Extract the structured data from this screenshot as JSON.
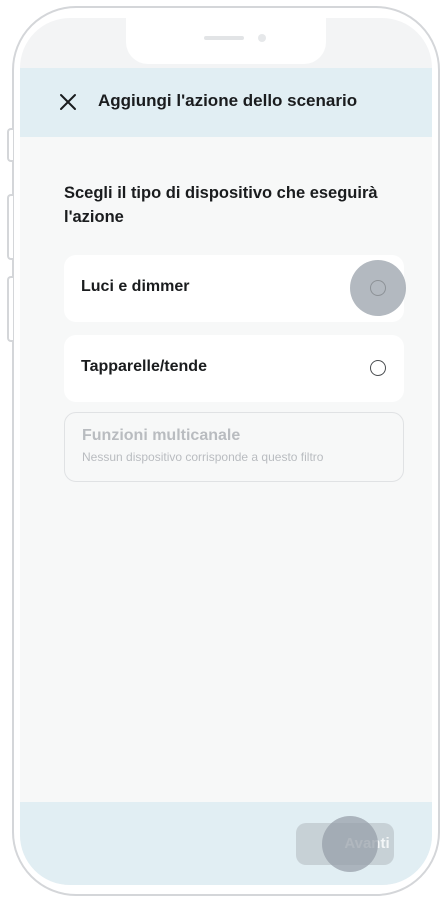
{
  "header": {
    "title": "Aggiungi l'azione dello scenario",
    "close_icon": "close-icon"
  },
  "main": {
    "question": "Scegli il tipo di dispositivo che eseguirà l'azione",
    "options": [
      {
        "label": "Luci e dimmer",
        "selected": false,
        "enabled": true
      },
      {
        "label": "Tapparelle/tende",
        "selected": false,
        "enabled": true
      }
    ],
    "disabled_option": {
      "label": "Funzioni multicanale",
      "subtitle": "Nessun dispositivo corrisponde a questo filtro"
    }
  },
  "footer": {
    "next_label": "Avanti",
    "next_enabled": false
  },
  "colors": {
    "header_bg": "#e1eef3",
    "content_bg": "#f7f8f8",
    "disabled_text": "#b9bcc0",
    "button_disabled_bg": "#c7d1d6"
  }
}
